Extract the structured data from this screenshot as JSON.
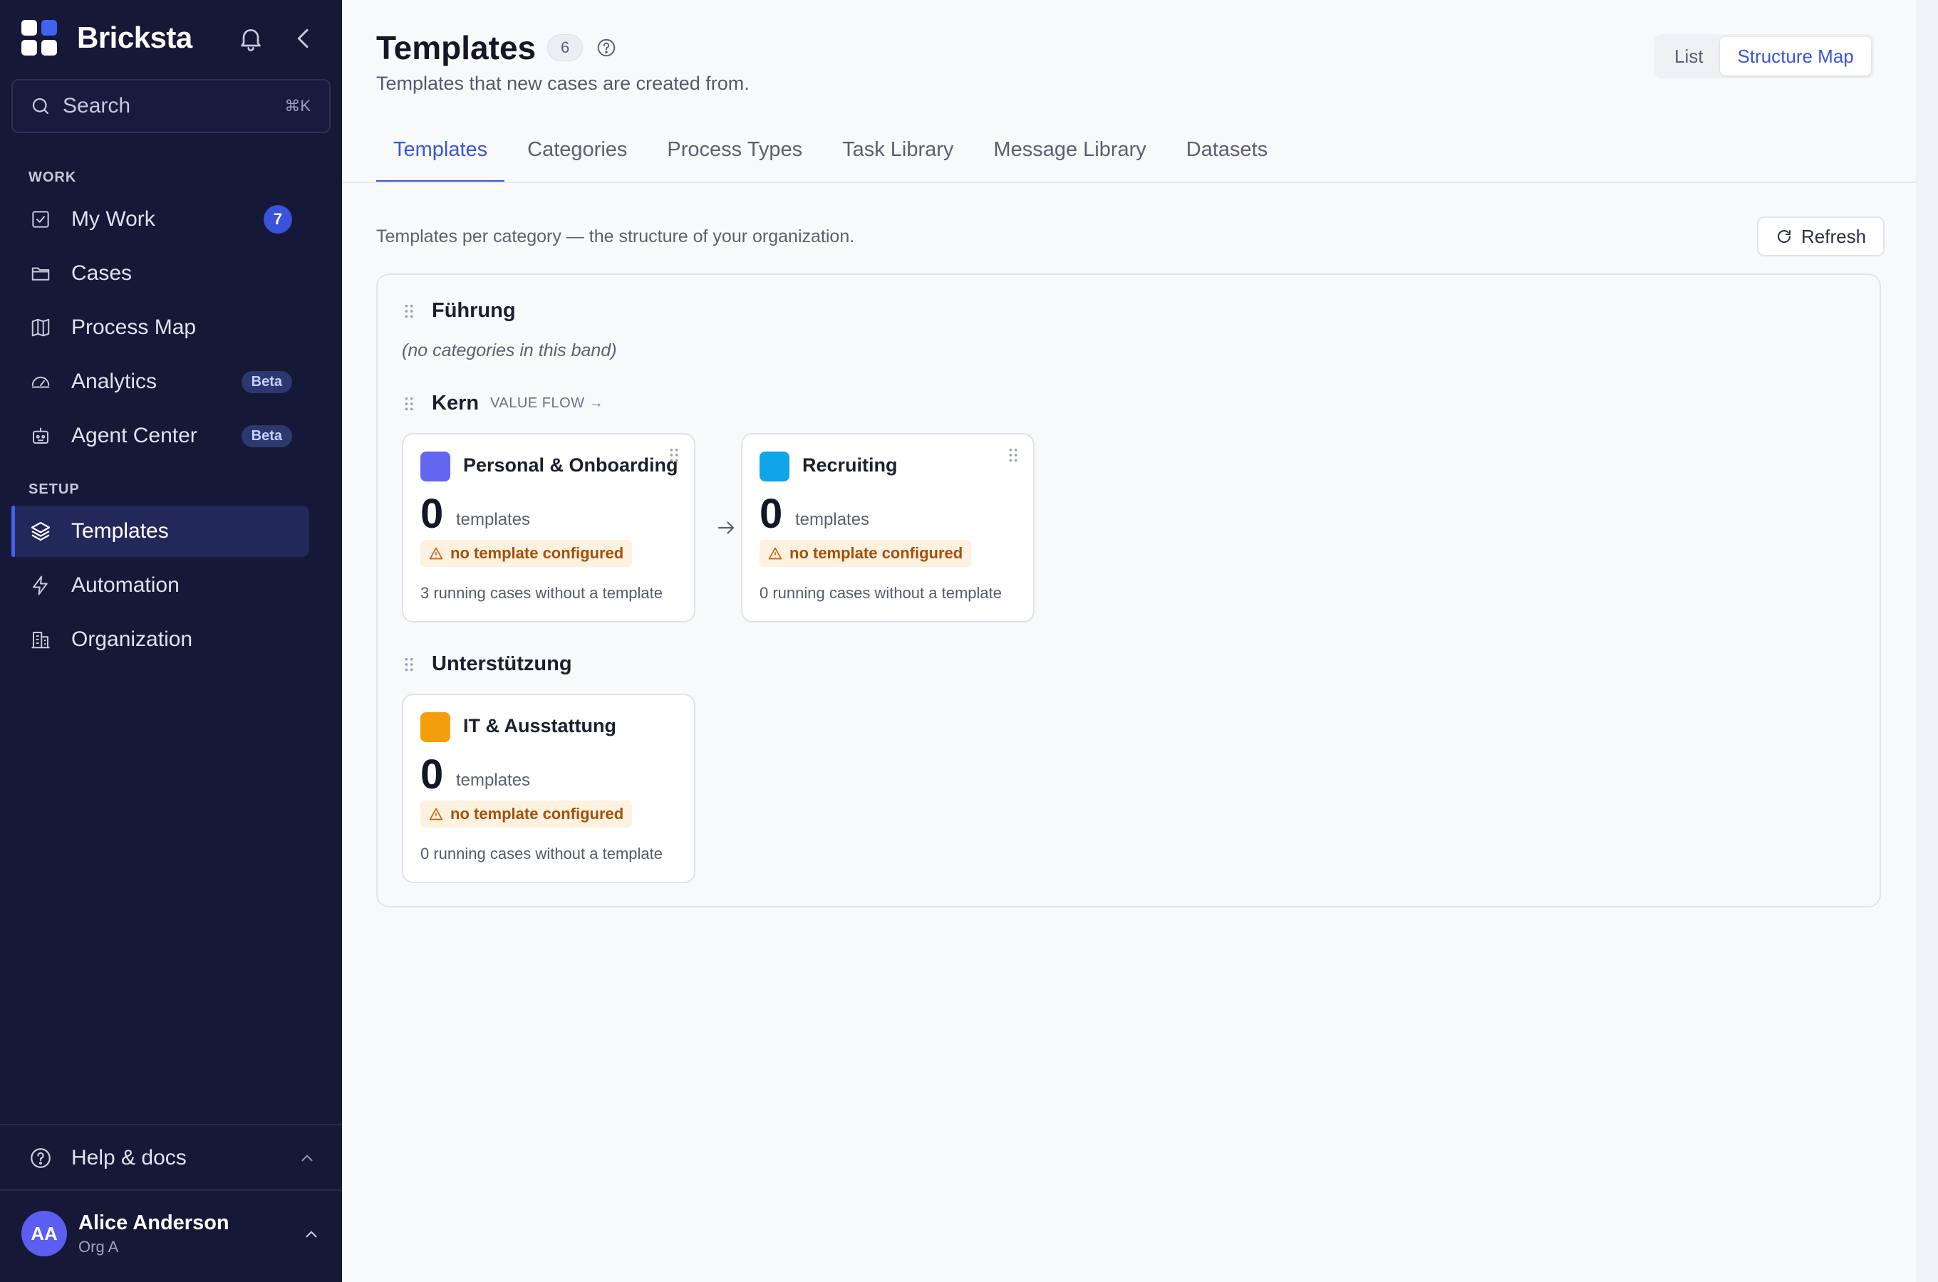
{
  "app": {
    "name": "Bricksta",
    "search": {
      "placeholder": "Search",
      "shortcut": "⌘K"
    },
    "sections": {
      "work": "WORK",
      "setup": "SETUP"
    },
    "nav": {
      "my_work": {
        "label": "My Work",
        "badge": "7"
      },
      "cases": {
        "label": "Cases"
      },
      "process_map": {
        "label": "Process Map"
      },
      "analytics": {
        "label": "Analytics",
        "badge": "Beta"
      },
      "agent_center": {
        "label": "Agent Center",
        "badge": "Beta"
      },
      "templates": {
        "label": "Templates"
      },
      "automation": {
        "label": "Automation"
      },
      "organization": {
        "label": "Organization"
      }
    },
    "help": {
      "label": "Help & docs"
    },
    "user": {
      "initials": "AA",
      "name": "Alice Anderson",
      "org": "Org A"
    }
  },
  "page": {
    "title": "Templates",
    "count": "6",
    "subtitle": "Templates that new cases are created from.",
    "view_toggle": {
      "list": "List",
      "structure_map": "Structure Map",
      "selected": "Structure Map"
    },
    "tabs": [
      {
        "label": "Templates",
        "active": true
      },
      {
        "label": "Categories"
      },
      {
        "label": "Process Types"
      },
      {
        "label": "Task Library"
      },
      {
        "label": "Message Library"
      },
      {
        "label": "Datasets"
      }
    ],
    "intro": "Templates per category — the structure of your organization.",
    "refresh": "Refresh"
  },
  "bands": [
    {
      "name": "Führung",
      "empty_text": "(no categories in this band)"
    },
    {
      "name": "Kern",
      "flow_label": "VALUE FLOW →",
      "categories": [
        {
          "name": "Personal & Onboarding",
          "color": "#6366f1",
          "count": "0",
          "unit": "templates",
          "warning": "no template configured",
          "running": "3 running cases without a template"
        },
        {
          "name": "Recruiting",
          "color": "#0ea5e9",
          "count": "0",
          "unit": "templates",
          "warning": "no template configured",
          "running": "0 running cases without a template"
        }
      ]
    },
    {
      "name": "Unterstützung",
      "categories": [
        {
          "name": "IT & Ausstattung",
          "color": "#f59e0b",
          "count": "0",
          "unit": "templates",
          "warning": "no template configured",
          "running": "0 running cases without a template"
        }
      ]
    }
  ]
}
